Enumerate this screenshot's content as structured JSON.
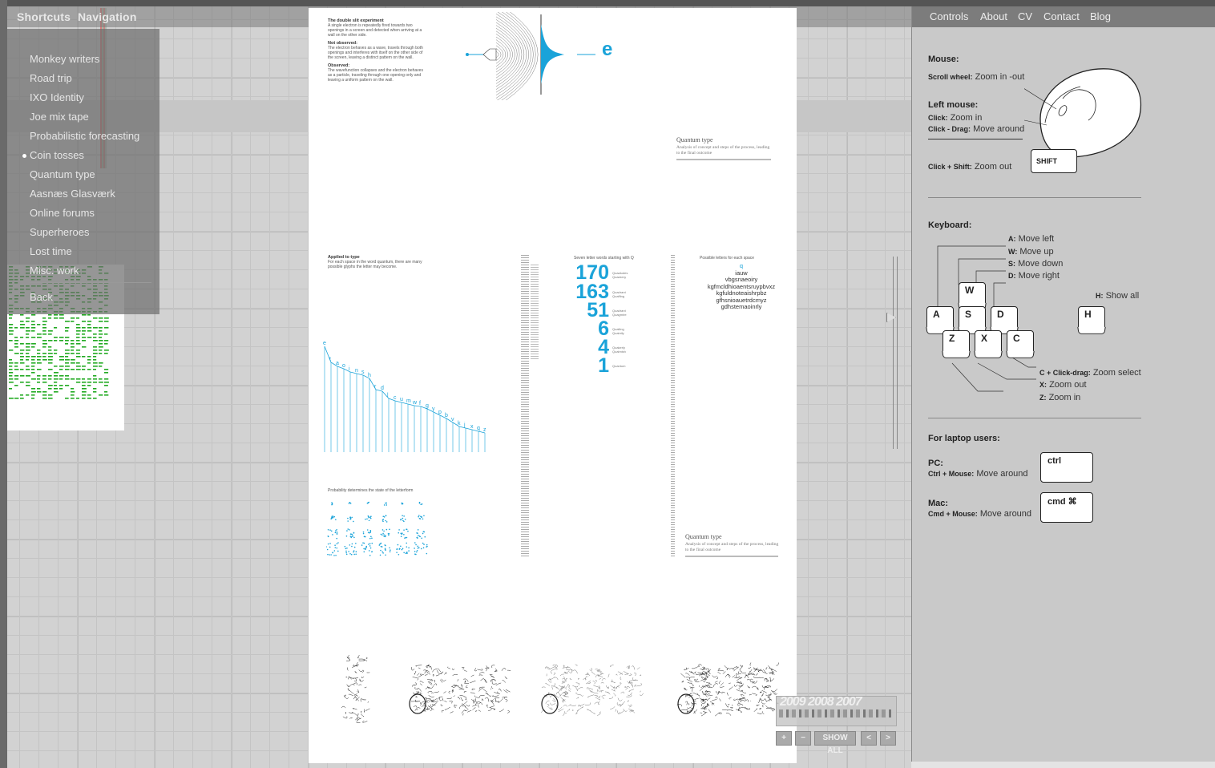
{
  "topnav": {
    "shortcuts_label": "Shortcuts",
    "navigation_label": "Navigation"
  },
  "nav": {
    "items": [
      {
        "label": "Monkey writers"
      },
      {
        "label": "Road trip"
      },
      {
        "label": "IXO Identity"
      },
      {
        "label": "Joe mix tape"
      },
      {
        "label": "Probabilistic forecasting"
      },
      {
        "label": "Coin tosses",
        "active": true
      },
      {
        "label": "Quantum type"
      },
      {
        "label": "Aasnæs Glasværk"
      },
      {
        "label": "Online forums"
      },
      {
        "label": "Superheroes"
      },
      {
        "label": "Lost time"
      },
      {
        "label": "Misc. work"
      }
    ],
    "back_label": "Back"
  },
  "page": {
    "experiment_title": "The double slit experiment",
    "experiment_text": "A single electron is repeatedly fired towards two openings in a screen and detected when arriving at a wall on the other side.",
    "not_observed_title": "Not observed:",
    "not_observed_text": "The electron behaves as a wave, travels through both openings and interferes with itself on the other side of the screen, leaving a distinct pattern on the wall.",
    "observed_title": "Observed:",
    "observed_text": "The wavefunction collapses and the electron behaves as a particle, traveling through one opening only and leaving a uniform pattern on the wall.",
    "electron_label": "e",
    "caption1_title": "Quantum type",
    "caption1_sub": "Analysis of concept and steps of the process, leading to the final outcome",
    "applied_title": "Applied to type",
    "applied_text": "For each space in the word quantum, there are many possible glyphs the letter may become.",
    "seven_title": "Seven letter words starting with Q",
    "counts": [
      "170",
      "163",
      "51",
      "6",
      "4",
      "1"
    ],
    "count_labels": [
      [
        "Quaaludes",
        "Quackery"
      ],
      [
        "Quadrant",
        "Quaffing"
      ],
      [
        "Quadrant",
        "Quagmire"
      ],
      [
        "Quailing",
        "Quaintly"
      ],
      [
        "Quakerly",
        "Qualmish"
      ],
      [
        "Quantum",
        ""
      ]
    ],
    "possible_title": "Possible letters for each space",
    "letters_rows": [
      "q",
      "iauw",
      "vbgsnaeoiry",
      "kgfmcldhioaentsruypbvxz",
      "kgfuldnoteaishrpbz",
      "gfhsnioauetrdcmyz",
      "gdhstemaoinrly"
    ],
    "chart_letters": "e t a o i n s h r d l c u m w f g y p b v k j x q z",
    "prob_title": "Probability determines the state of the letterform",
    "caption2_title": "Quantum type",
    "caption2_sub": "Analysis of concept and steps of the process, leading to the final outcome"
  },
  "controls": {
    "zoom_in": "+",
    "zoom_out": "−",
    "show_all": "SHOW ALL",
    "prev": "<",
    "next": ">",
    "years": "2009 2008 2007"
  },
  "rightnav": {
    "controls": "Controls",
    "about": "About",
    "cv": "CV",
    "contact": "Contact",
    "blog": "Blog"
  },
  "help": {
    "mouse_title": "Mouse:",
    "scroll_key": "Scroll wheel:",
    "scroll_val": "Zoom in -out",
    "left_title": "Left mouse:",
    "click_key": "Click:",
    "click_val": "Zoom in",
    "drag_key": "Click - Drag:",
    "drag_val": "Move around",
    "shift_key": "Click + Shift:",
    "shift_val": "Zoom out",
    "shift_label": "SHIFT",
    "keyboard_title": "Keyboard:",
    "a_key": "A:",
    "a_val": "Move left",
    "w_key": "W:",
    "w_val": "Move up",
    "s_key": "S:",
    "s_val": "Move down",
    "d_key": "D:",
    "d_val": "Move right",
    "h_key": "H:",
    "h_val": "Show all",
    "c_key": "C + Click-drag:",
    "c_val": "Zoom select",
    "x_key": "X:",
    "x_val": "Zoom out",
    "z_key": "Z:",
    "z_val": "Zoom in",
    "keys": {
      "w": "W",
      "a": "A",
      "s": "S",
      "d": "D",
      "z": "Z",
      "x": "X",
      "c": "C",
      "h": "H"
    },
    "laptop_title": "For laptop users:",
    "pc_title": "PC:",
    "pc_key": "Ctrl + Mouse:",
    "pc_val": "Move around",
    "mac_title": "Mac:",
    "mac_key": "Cmd + Mouse:",
    "mac_val": "Move around",
    "ctrl_label": "ctrl",
    "cmd_label": "cmd ⌘"
  }
}
